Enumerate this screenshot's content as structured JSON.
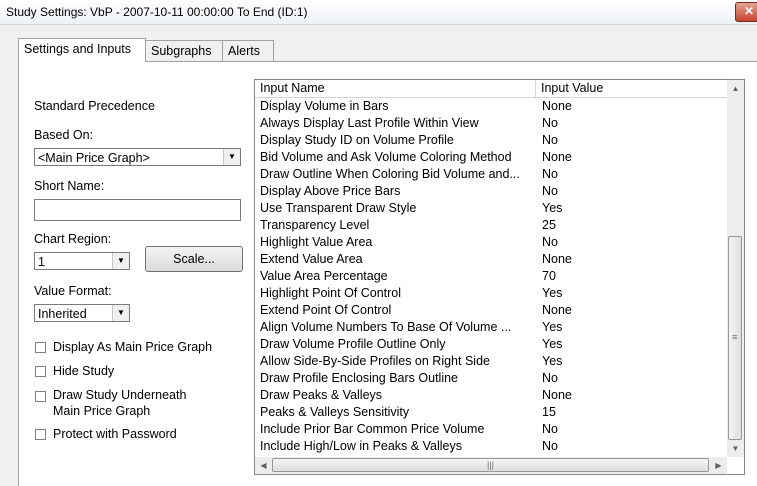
{
  "window": {
    "title": "Study Settings: VbP - 2007-10-11  00:00:00 To End (ID:1)",
    "close_glyph": "✕"
  },
  "tabs": [
    {
      "label": "Settings and Inputs"
    },
    {
      "label": "Subgraphs"
    },
    {
      "label": "Alerts"
    }
  ],
  "left": {
    "precedence_label": "Standard Precedence",
    "based_on_label": "Based On:",
    "based_on_value": "<Main Price Graph>",
    "short_name_label": "Short Name:",
    "short_name_value": "",
    "chart_region_label": "Chart Region:",
    "chart_region_value": "1",
    "scale_button": "Scale...",
    "value_format_label": "Value Format:",
    "value_format_value": "Inherited",
    "checkboxes": [
      {
        "label": "Display As Main Price Graph",
        "checked": false
      },
      {
        "label": "Hide Study",
        "checked": false
      },
      {
        "label": "Draw Study Underneath Main Price Graph",
        "line1": "Draw Study Underneath",
        "line2": "Main Price Graph",
        "checked": false
      },
      {
        "label": "Protect with Password",
        "checked": false
      }
    ]
  },
  "grid": {
    "col_name": "Input Name",
    "col_value": "Input Value",
    "rows": [
      {
        "name": "Display Volume in Bars",
        "value": "None"
      },
      {
        "name": "Always Display Last Profile Within View",
        "value": "No"
      },
      {
        "name": "Display Study ID on Volume Profile",
        "value": "No"
      },
      {
        "name": "Bid Volume and Ask Volume Coloring Method",
        "value": "None"
      },
      {
        "name": "Draw Outline When Coloring Bid Volume and...",
        "value": "No"
      },
      {
        "name": "Display Above Price Bars",
        "value": "No"
      },
      {
        "name": "Use Transparent Draw Style",
        "value": "Yes"
      },
      {
        "name": "Transparency Level",
        "value": "25"
      },
      {
        "name": "Highlight Value Area",
        "value": "No"
      },
      {
        "name": "Extend Value Area",
        "value": "None"
      },
      {
        "name": "Value Area Percentage",
        "value": "70"
      },
      {
        "name": "Highlight Point Of Control",
        "value": "Yes"
      },
      {
        "name": "Extend Point Of Control",
        "value": "None"
      },
      {
        "name": "Align Volume Numbers To Base Of Volume ...",
        "value": "Yes"
      },
      {
        "name": "Draw Volume Profile Outline Only",
        "value": "Yes"
      },
      {
        "name": "Allow Side-By-Side Profiles on Right Side",
        "value": "Yes"
      },
      {
        "name": "Draw Profile Enclosing Bars Outline",
        "value": "No"
      },
      {
        "name": "Draw Peaks & Valleys",
        "value": "None"
      },
      {
        "name": "Peaks & Valleys Sensitivity",
        "value": "15"
      },
      {
        "name": "Include Prior Bar Common Price Volume",
        "value": "No"
      },
      {
        "name": "Include High/Low in Peaks & Valleys",
        "value": "No"
      }
    ]
  }
}
